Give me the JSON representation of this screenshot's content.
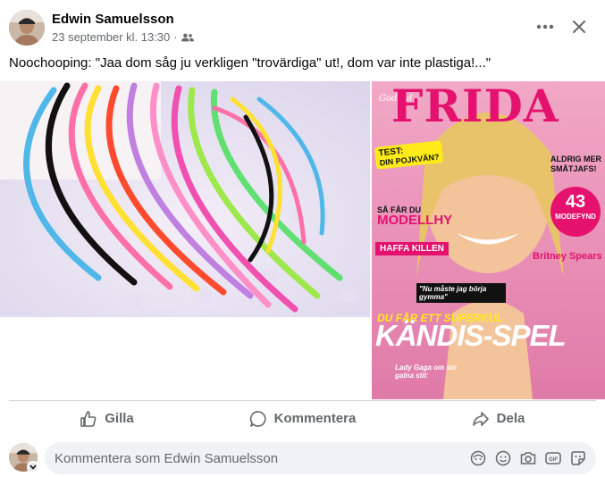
{
  "post": {
    "author": "Edwin Samuelsson",
    "timestamp": "23 september kl. 13:30",
    "separator": "·",
    "audience_icon": "friends-icon",
    "text": "Noochooping: \"Jaa dom såg ju verkligen \"trovärdiga\" ut!, dom var inte plastiga!...\""
  },
  "magazine": {
    "brand": "FRIDA",
    "greeting": "God Jul",
    "test_label": "TEST:",
    "test_text": "DIN POJKVÄN?",
    "modell_line1": "SÅ FÅR DU",
    "modell_line2": "MODELLHY",
    "haffa": "HAFFA KILLEN",
    "aldrig": "ALDRIG MER SMÅTJAFS!",
    "modefynd_num": "43",
    "modefynd_label": "MODEFYND",
    "britney": "Britney Spears",
    "gymma": "\"Nu måste jag börja gymma\"",
    "superkul": "DU FÅR ETT SUPERKUL",
    "kandis": "KÄNDIS-SPEL",
    "gaga": "Lady Gaga om sin galna stil:"
  },
  "actions": {
    "like": "Gilla",
    "comment": "Kommentera",
    "share": "Dela"
  },
  "comment_box": {
    "placeholder": "Kommentera som Edwin Samuelsson",
    "icons": [
      "avatar-sticker-icon",
      "emoji-icon",
      "camera-icon",
      "gif-icon",
      "sticker-icon"
    ]
  }
}
